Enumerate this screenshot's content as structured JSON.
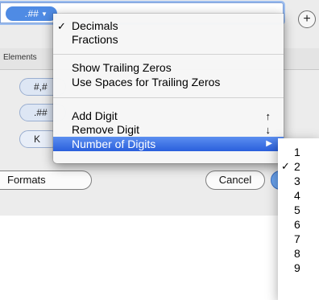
{
  "token_field": {
    "token_text": ".##",
    "token_arrow": "▼"
  },
  "add_button_icon": "plus-icon",
  "add_button_glyph": "+",
  "tab": {
    "label": "Elements"
  },
  "element_tokens": [
    {
      "text": "#,#"
    },
    {
      "text": ".##"
    },
    {
      "text": "K"
    }
  ],
  "buttons": {
    "formats": "Formats",
    "cancel": "Cancel"
  },
  "menu": {
    "items": {
      "decimals": {
        "label": "Decimals",
        "check": "✓"
      },
      "fractions": {
        "label": "Fractions"
      },
      "show_trailing_zeros": {
        "label": "Show Trailing Zeros"
      },
      "use_spaces": {
        "label": "Use Spaces for Trailing Zeros"
      },
      "add_digit": {
        "label": "Add Digit",
        "shortcut": "↑"
      },
      "remove_digit": {
        "label": "Remove Digit",
        "shortcut": "↓"
      },
      "number_of_digits": {
        "label": "Number of Digits",
        "arrow": "▶"
      }
    }
  },
  "submenu": {
    "check": "✓",
    "items": [
      "1",
      "2",
      "3",
      "4",
      "5",
      "6",
      "7",
      "8",
      "9"
    ],
    "selected": "2"
  },
  "colors": {
    "highlight": "#3c6fe4",
    "token_blue": "#4f8be4"
  }
}
